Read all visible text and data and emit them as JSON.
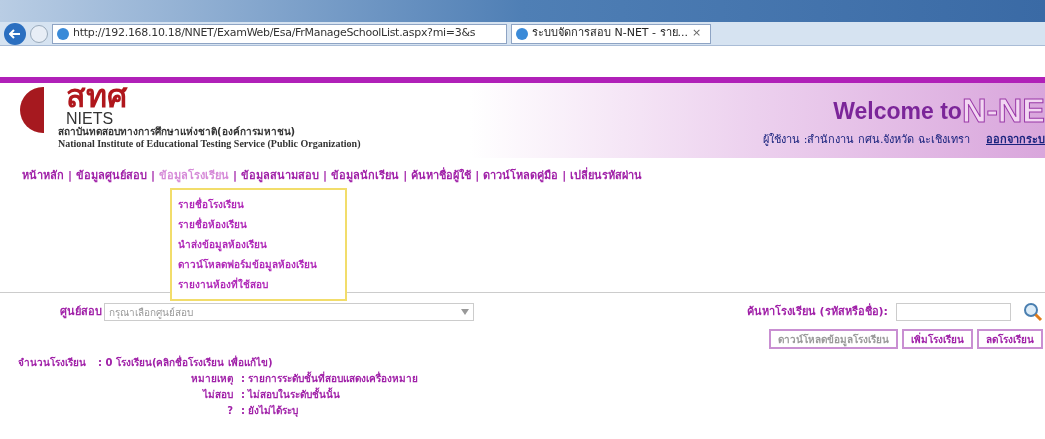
{
  "browser": {
    "url": "http://192.168.10.18/NNET/ExamWeb/Esa/FrManageSchoolList.aspx?mi=3&s",
    "tab": "ระบบจัดการสอบ N-NET - ราย...",
    "tab_close": "×"
  },
  "header": {
    "logo_thai": "สทศ",
    "logo_en": "NIETS",
    "org_thai": "สถาบันทดสอบทางการศึกษาแห่งชาติ(องค์การมหาชน)",
    "org_en": "National Institute of Educational Testing Service (Public Organization)",
    "welcome": "Welcome to",
    "brand": "N-NE",
    "user": "ผู้ใช้งาน :สำนักงาน กศน.จังหวัด ฉะเชิงเทรา",
    "logout": "ออกจากระบ"
  },
  "nav_separator": "|",
  "nav": [
    {
      "label": "หน้าหลัก",
      "selected": false
    },
    {
      "label": "ข้อมูลศูนย์สอบ",
      "selected": false
    },
    {
      "label": "ข้อมูลโรงเรียน",
      "selected": true
    },
    {
      "label": "ข้อมูลสนามสอบ",
      "selected": false
    },
    {
      "label": "ข้อมูลนักเรียน",
      "selected": false
    },
    {
      "label": "ค้นหาชื่อผู้ใช้",
      "selected": false
    },
    {
      "label": "ดาวน์โหลดคู่มือ",
      "selected": false
    },
    {
      "label": "เปลี่ยนรหัสผ่าน",
      "selected": false
    }
  ],
  "submenu": [
    "รายชื่อโรงเรียน",
    "รายชื่อห้องเรียน",
    "นำส่งข้อมูลห้องเรียน",
    "ดาวน์โหลดฟอร์มข้อมูลห้องเรียน",
    "รายงานห้องที่ใช้สอบ"
  ],
  "filter": {
    "label": "ศูนย์สอบ",
    "placeholder": "กรุณาเลือกศูนย์สอบ"
  },
  "search": {
    "label": "ค้นหาโรงเรียน  (รหัสหรือชื่อ):"
  },
  "buttons": [
    {
      "label": "ดาวน์โหลดข้อมูลโรงเรียน",
      "disabled": true
    },
    {
      "label": "เพิ่มโรงเรียน",
      "disabled": false
    },
    {
      "label": "ลดโรงเรียน",
      "disabled": false
    }
  ],
  "summary": {
    "label": "จำนวนโรงเรียน",
    "value": ": 0 โรงเรียน(คลิกชื่อโรงเรียน   เพื่อแก้ไข)"
  },
  "notes": [
    {
      "label": "หมายเหตุ",
      "value": ": รายการระดับชั้นที่สอบแสดงเครื่องหมาย"
    },
    {
      "label": "ไม่สอบ",
      "value": ": ไม่สอบในระดับชั้นนั้น"
    },
    {
      "label": "?",
      "value": ": ยังไม่ได้ระบุ"
    }
  ]
}
